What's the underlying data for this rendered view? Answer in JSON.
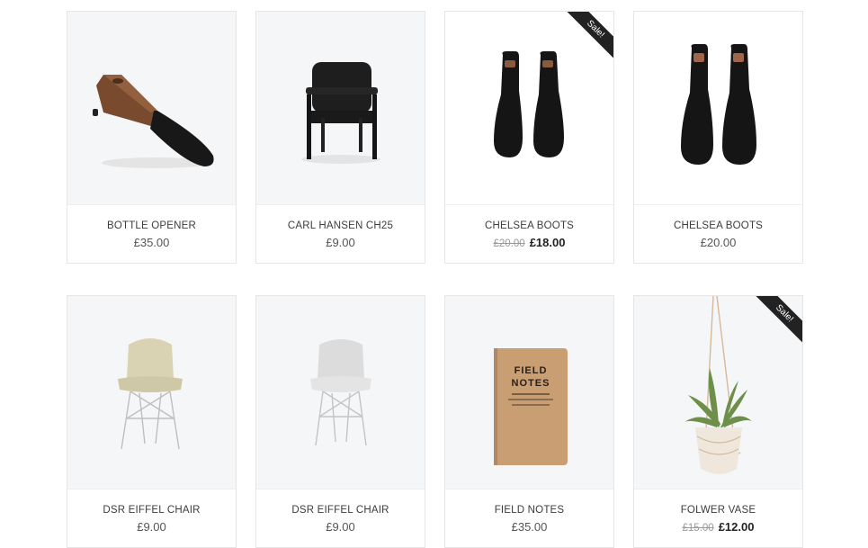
{
  "products": [
    {
      "name": "BOTTLE OPENER",
      "price": "£35.00",
      "old_price": "",
      "sale": false,
      "badge": "",
      "image": "bottle-opener-image"
    },
    {
      "name": "CARL HANSEN CH25",
      "price": "£9.00",
      "old_price": "",
      "sale": false,
      "badge": "",
      "image": "chair-image"
    },
    {
      "name": "CHELSEA BOOTS",
      "price": "£18.00",
      "old_price": "£20.00",
      "sale": true,
      "badge": "Sale!",
      "image": "boots-image"
    },
    {
      "name": "CHELSEA BOOTS",
      "price": "£20.00",
      "old_price": "",
      "sale": false,
      "badge": "",
      "image": "boots-image"
    },
    {
      "name": "DSR EIFFEL CHAIR",
      "price": "£9.00",
      "old_price": "",
      "sale": false,
      "badge": "",
      "image": "eiffel-chair-beige-image"
    },
    {
      "name": "DSR EIFFEL CHAIR",
      "price": "£9.00",
      "old_price": "",
      "sale": false,
      "badge": "",
      "image": "eiffel-chair-grey-image"
    },
    {
      "name": "FIELD NOTES",
      "price": "£35.00",
      "old_price": "",
      "sale": false,
      "badge": "",
      "image": "notebook-image",
      "image_text": [
        "FIELD",
        "NOTES"
      ]
    },
    {
      "name": "FOLWER VASE",
      "price": "£12.00",
      "old_price": "£15.00",
      "sale": true,
      "badge": "Sale!",
      "image": "hanging-plant-image"
    }
  ]
}
